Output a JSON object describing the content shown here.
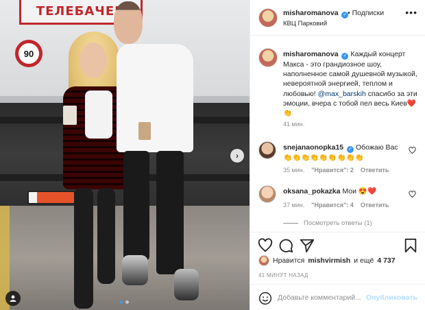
{
  "post": {
    "author": "misharomanova",
    "follow_label": "• Подписки",
    "location": "КВЦ Парковий",
    "more": "•••"
  },
  "photo": {
    "truck_sign": "ТЕЛЕБАЧЕН",
    "speed_sign": "90",
    "carousel_dots": 2,
    "active_dot": 1
  },
  "caption": {
    "author": "misharomanova",
    "text_1": "Каждый концерт Макса - это грандиозное шоу, наполненное самой душевной музыкой, невероятной энергией, теплом и любовью! ",
    "mention": "@max_barskih",
    "text_2": " спасибо за эти эмоции, вчера с тобой пел весь Киев❤️ 👏",
    "time": "41 мин."
  },
  "comments": [
    {
      "author": "snejanaonopka15",
      "verified": true,
      "text": "Обожаю Вас 👏👏👏👏👏👏👏👏👏",
      "time": "35 мин.",
      "likes": "\"Нравится\": 2",
      "reply": "Ответить"
    },
    {
      "author": "oksana_pokazka",
      "verified": false,
      "text": "Мои 😍❤️",
      "time": "37 мин.",
      "likes": "\"Нравится\": 4",
      "reply": "Ответить"
    }
  ],
  "replies_label": "Посмотреть ответы (1)",
  "likes": {
    "prefix": "Нравится",
    "user": "mishvirmish",
    "suffix": "и ещё",
    "count": "4 737"
  },
  "post_time": "41 МИНУТ НАЗАД",
  "comment_box": {
    "placeholder": "Добавьте комментарий...",
    "publish_label": "Опубликовать"
  },
  "colors": {
    "link": "#00376b",
    "verified": "#3897f0",
    "muted": "#8e8e8e",
    "publish_disabled": "#b3dbff"
  }
}
